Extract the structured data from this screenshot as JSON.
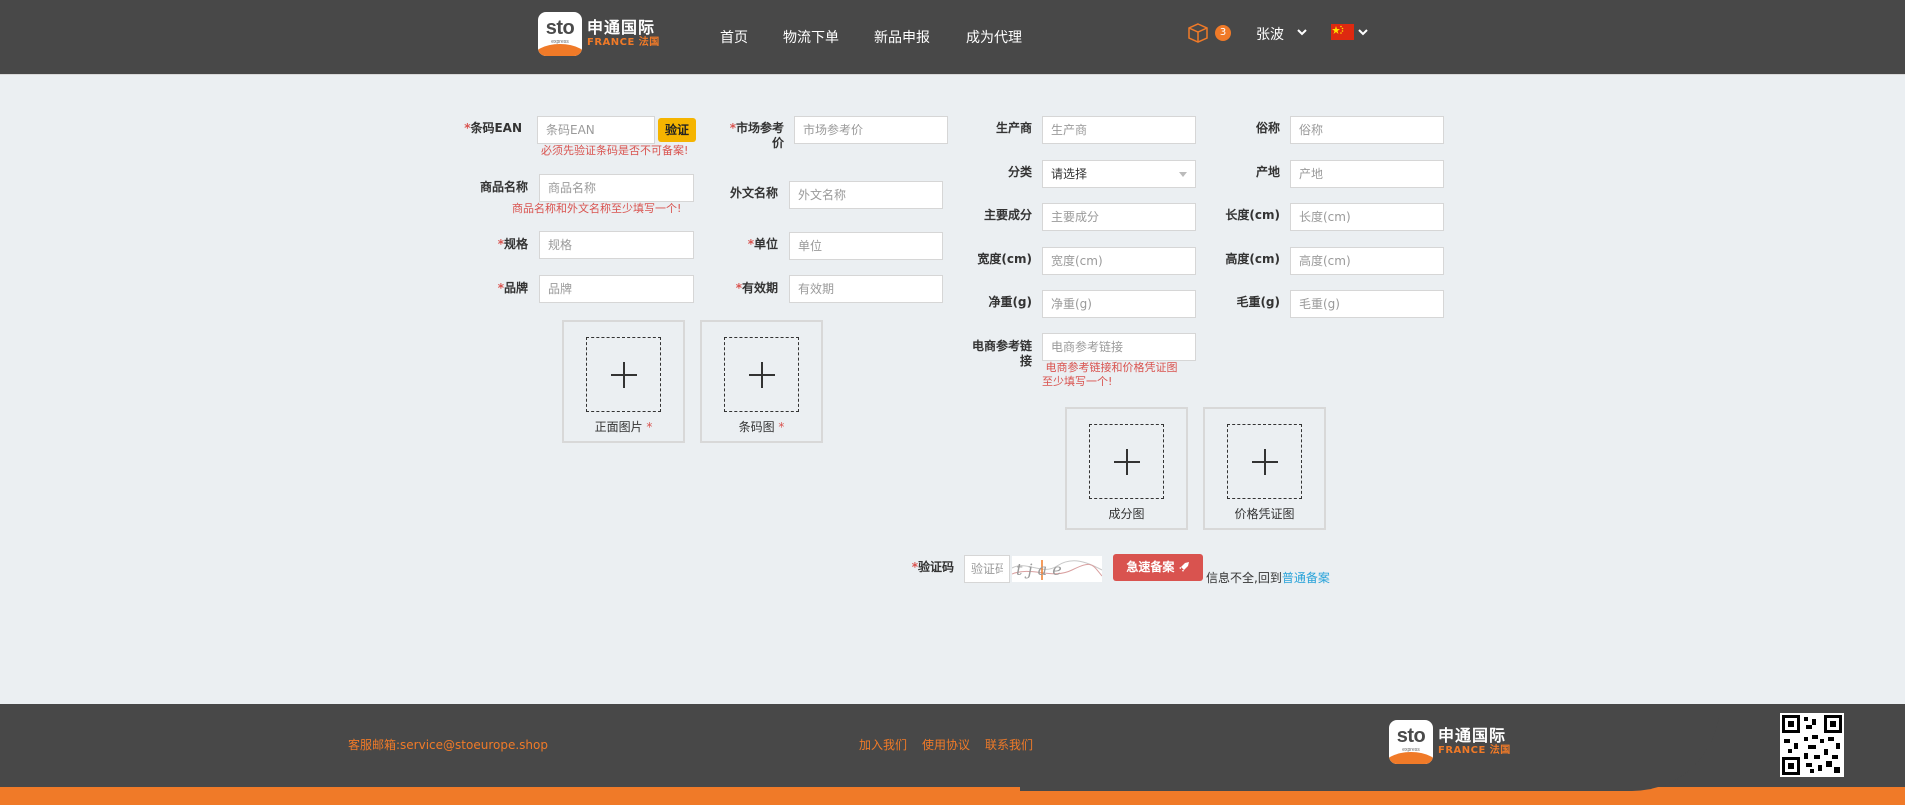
{
  "header": {
    "brand_cn": "申通国际",
    "brand_fr": "FRANCE 法国",
    "brand_sto": "sto",
    "brand_express": "express",
    "nav": [
      "首页",
      "物流下单",
      "新品申报",
      "成为代理"
    ],
    "cart_count": "3",
    "user_name": "张波",
    "language_flag": "cn-flag-icon"
  },
  "form": {
    "ean": {
      "label": "条码EAN",
      "placeholder": "条码EAN",
      "verify_label": "验证",
      "error": "必须先验证条码是否不可备案!"
    },
    "product_name": {
      "label": "商品名称",
      "placeholder": "商品名称",
      "error": "商品名称和外文名称至少填写一个!"
    },
    "spec": {
      "label": "规格",
      "placeholder": "规格"
    },
    "brand": {
      "label": "品牌",
      "placeholder": "品牌"
    },
    "market_price": {
      "label_line1": "市场参考",
      "label_line2": "价",
      "placeholder": "市场参考价"
    },
    "foreign_name": {
      "label": "外文名称",
      "placeholder": "外文名称"
    },
    "unit": {
      "label": "单位",
      "placeholder": "单位"
    },
    "expiry": {
      "label": "有效期",
      "placeholder": "有效期"
    },
    "manufacturer": {
      "label": "生产商",
      "placeholder": "生产商"
    },
    "category": {
      "label": "分类",
      "value": "请选择"
    },
    "main_ingredient": {
      "label": "主要成分",
      "placeholder": "主要成分"
    },
    "width": {
      "label": "宽度(cm)",
      "placeholder": "宽度(cm)"
    },
    "net_weight": {
      "label": "净重(g)",
      "placeholder": "净重(g)"
    },
    "ecommerce_link": {
      "label_line1": "电商参考链",
      "label_line2": "接",
      "placeholder": "电商参考链接",
      "error_line1": "电商参考链接和价格凭证图",
      "error_line2": "至少填写一个!"
    },
    "alias": {
      "label": "俗称",
      "placeholder": "俗称"
    },
    "origin": {
      "label": "产地",
      "placeholder": "产地"
    },
    "length": {
      "label": "长度(cm)",
      "placeholder": "长度(cm)"
    },
    "height": {
      "label": "高度(cm)",
      "placeholder": "高度(cm)"
    },
    "gross_weight": {
      "label": "毛重(g)",
      "placeholder": "毛重(g)"
    },
    "uploads": {
      "front_image": "正面图片",
      "barcode_image": "条码图",
      "ingredient_image": "成分图",
      "price_proof_image": "价格凭证图"
    },
    "captcha": {
      "label": "验证码",
      "placeholder": "验证码",
      "image_text": "t j a e"
    },
    "submit_label": "急速备案",
    "fallback_text": "信息不全,回到",
    "fallback_link": "普通备案",
    "required_mark": "*"
  },
  "footer": {
    "email": "客服邮箱:service@stoeurope.shop",
    "links": [
      "加入我们",
      "使用协议",
      "联系我们"
    ],
    "brand_cn": "申通国际",
    "brand_fr": "FRANCE 法国",
    "brand_sto": "sto",
    "brand_express": "express"
  },
  "colors": {
    "accent": "#f07a28",
    "header_bg": "#484848",
    "error": "#d9534f",
    "verify": "#f5b400",
    "link": "#29a3d9"
  }
}
